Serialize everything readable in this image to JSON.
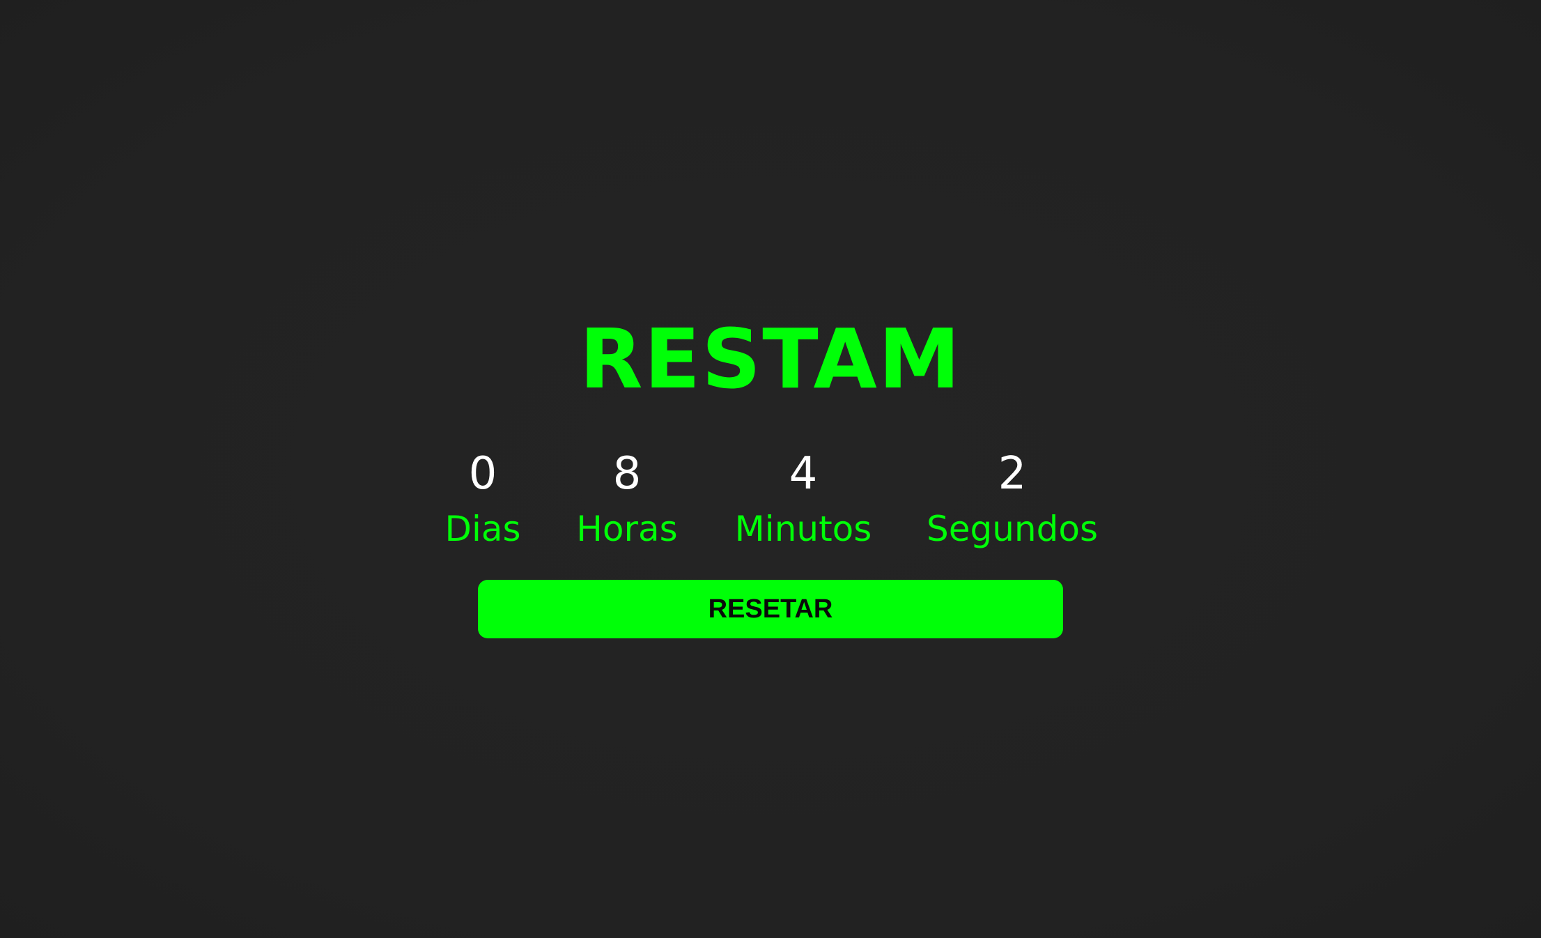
{
  "title": "RESTAM",
  "countdown": [
    {
      "value": "0",
      "label": "Dias"
    },
    {
      "value": "8",
      "label": "Horas"
    },
    {
      "value": "4",
      "label": "Minutos"
    },
    {
      "value": "2",
      "label": "Segundos"
    }
  ],
  "reset_button": {
    "label": "RESETAR"
  },
  "colors": {
    "background": "#232323",
    "accent": "#00ff08",
    "digits": "#ffffff",
    "button_text": "#0a0a0a"
  }
}
